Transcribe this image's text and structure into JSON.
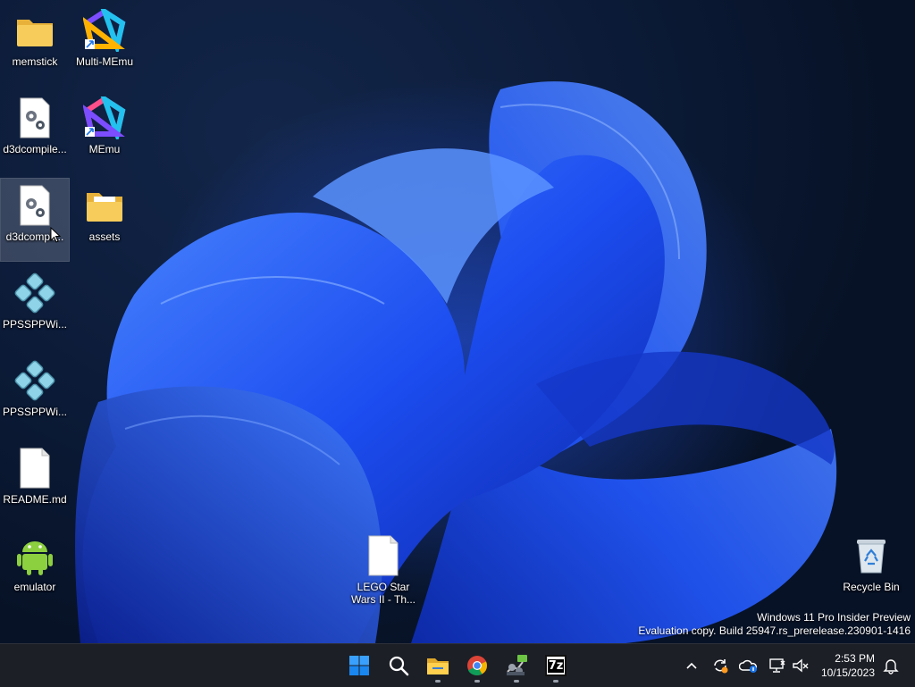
{
  "desktop": {
    "icons": [
      {
        "label": "memstick"
      },
      {
        "label": "Multi-MEmu"
      },
      {
        "label": "d3dcompile..."
      },
      {
        "label": "MEmu"
      },
      {
        "label": "d3dcompil..."
      },
      {
        "label": "assets"
      },
      {
        "label": "PPSSPPWi..."
      },
      {
        "label": "PPSSPPWi..."
      },
      {
        "label": "README.md"
      },
      {
        "label": "emulator"
      },
      {
        "label": "LEGO Star Wars II - Th..."
      },
      {
        "label": "Recycle Bin"
      }
    ],
    "watermark": {
      "line1": "Windows 11 Pro Insider Preview",
      "line2": "Evaluation copy. Build 25947.rs_prerelease.230901-1416"
    }
  },
  "taskbar": {
    "apps": [
      "start-icon",
      "search-icon",
      "file-explorer-icon",
      "chrome-icon",
      "network-tool-icon",
      "7zip-icon"
    ],
    "sevenzip_text": "7z",
    "clock": {
      "time": "2:53 PM",
      "date": "10/15/2023"
    }
  },
  "colors": {
    "accent": "#0a64ff",
    "taskbar": "#1c1f26",
    "folder": "#f4c64a"
  }
}
